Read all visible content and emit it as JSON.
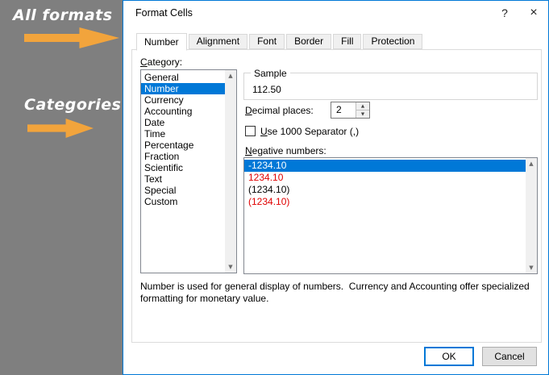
{
  "annotations": {
    "all_formats": "All formats",
    "categories": "Categories"
  },
  "colors": {
    "selection": "#0078d7",
    "negative_red": "#e00000",
    "arrow": "#f2a43c",
    "dialog_border": "#0078d7",
    "panel_gray": "#7f7f7f"
  },
  "icons": {
    "help": "?",
    "close": "×",
    "scroll_up": "▲",
    "scroll_down": "▼",
    "spin_up": "▲",
    "spin_down": "▼"
  },
  "dialog": {
    "title": "Format Cells",
    "tabs": [
      {
        "label": "Number",
        "selected": true
      },
      {
        "label": "Alignment",
        "selected": false
      },
      {
        "label": "Font",
        "selected": false
      },
      {
        "label": "Border",
        "selected": false
      },
      {
        "label": "Fill",
        "selected": false
      },
      {
        "label": "Protection",
        "selected": false
      }
    ],
    "category": {
      "label": "Category:",
      "selected": "Number",
      "items": [
        {
          "label": "General",
          "selected": false
        },
        {
          "label": "Number",
          "selected": true
        },
        {
          "label": "Currency",
          "selected": false
        },
        {
          "label": "Accounting",
          "selected": false
        },
        {
          "label": "Date",
          "selected": false
        },
        {
          "label": "Time",
          "selected": false
        },
        {
          "label": "Percentage",
          "selected": false
        },
        {
          "label": "Fraction",
          "selected": false
        },
        {
          "label": "Scientific",
          "selected": false
        },
        {
          "label": "Text",
          "selected": false
        },
        {
          "label": "Special",
          "selected": false
        },
        {
          "label": "Custom",
          "selected": false
        }
      ]
    },
    "sample": {
      "label": "Sample",
      "value": "112.50"
    },
    "decimal_places": {
      "label": "Decimal places:",
      "value": "2"
    },
    "use_1000_separator": {
      "label": "Use 1000 Separator (,)",
      "checked": false
    },
    "negative_numbers": {
      "label": "Negative numbers:",
      "items": [
        {
          "label": "-1234.10",
          "selected": true,
          "color": "default"
        },
        {
          "label": "1234.10",
          "selected": false,
          "color": "red"
        },
        {
          "label": "(1234.10)",
          "selected": false,
          "color": "default"
        },
        {
          "label": "(1234.10)",
          "selected": false,
          "color": "red"
        }
      ]
    },
    "description": "Number is used for general display of numbers.  Currency and Accounting offer specialized formatting for monetary value.",
    "buttons": {
      "ok": "OK",
      "cancel": "Cancel"
    }
  }
}
